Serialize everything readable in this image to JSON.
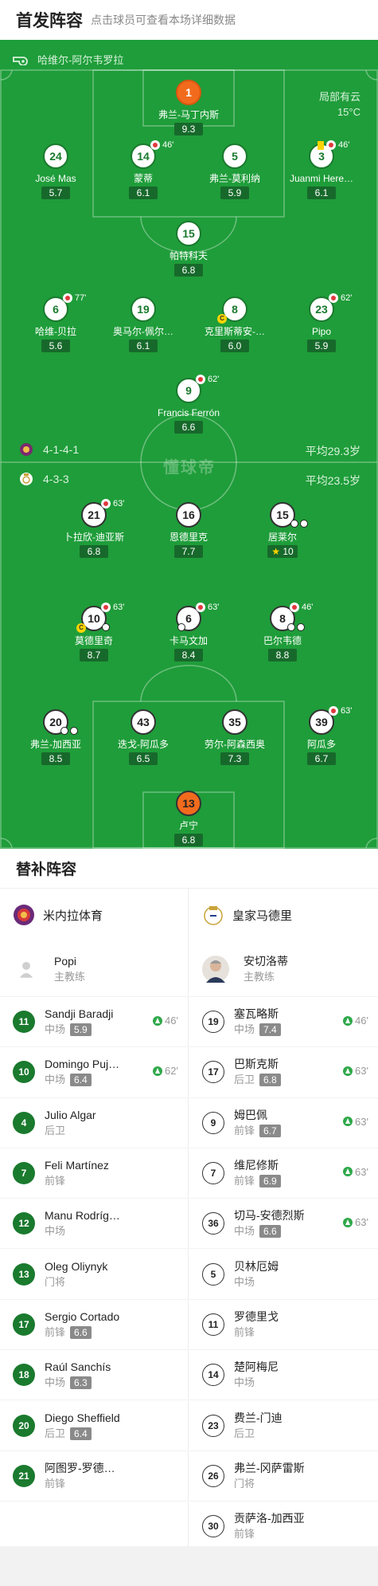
{
  "header": {
    "title": "首发阵容",
    "subtitle": "点击球员可查看本场详细数据"
  },
  "match": {
    "venue": "哈维尔-阿尔韦罗拉",
    "weather": "局部有云",
    "temperature": "15°C",
    "watermark": "懂球帝"
  },
  "home": {
    "formation": "4-1-4-1",
    "avg_age": "平均29.3岁",
    "players": [
      {
        "num": "1",
        "name": "弗兰-马丁内斯",
        "rating": "9.3"
      },
      {
        "num": "24",
        "name": "José Mas",
        "rating": "5.7"
      },
      {
        "num": "14",
        "name": "蒙蒂",
        "rating": "6.1",
        "sub_min": "46'"
      },
      {
        "num": "5",
        "name": "弗兰-莫利纳",
        "rating": "5.9"
      },
      {
        "num": "3",
        "name": "Juanmi Here…",
        "rating": "6.1",
        "sub_min": "46'"
      },
      {
        "num": "15",
        "name": "帕特科夫",
        "rating": "6.8"
      },
      {
        "num": "6",
        "name": "哈维-贝拉",
        "rating": "5.6",
        "sub_min": "77'"
      },
      {
        "num": "19",
        "name": "奥马尔-佩尔…",
        "rating": "6.1"
      },
      {
        "num": "8",
        "name": "克里斯蒂安-…",
        "rating": "6.0",
        "captain": "C"
      },
      {
        "num": "23",
        "name": "Pipo",
        "rating": "5.9",
        "sub_min": "62'"
      },
      {
        "num": "9",
        "name": "Francis Ferrón",
        "rating": "6.6",
        "sub_min": "62'"
      }
    ]
  },
  "away": {
    "formation": "4-3-3",
    "avg_age": "平均23.5岁",
    "players": [
      {
        "num": "21",
        "name": "卜拉欣-迪亚斯",
        "rating": "6.8",
        "sub_min": "63'"
      },
      {
        "num": "16",
        "name": "恩德里克",
        "rating": "7.7"
      },
      {
        "num": "15",
        "name": "居莱尔",
        "rating": "10"
      },
      {
        "num": "10",
        "name": "莫德里奇",
        "rating": "8.7",
        "sub_min": "63'",
        "captain": "C"
      },
      {
        "num": "6",
        "name": "卡马文加",
        "rating": "8.4",
        "sub_min": "63'"
      },
      {
        "num": "8",
        "name": "巴尔韦德",
        "rating": "8.8",
        "sub_min": "46'"
      },
      {
        "num": "20",
        "name": "弗兰-加西亚",
        "rating": "8.5"
      },
      {
        "num": "43",
        "name": "迭戈-阿瓜多",
        "rating": "6.5"
      },
      {
        "num": "35",
        "name": "劳尔-阿森西奥",
        "rating": "7.3"
      },
      {
        "num": "39",
        "name": "阿瓜多",
        "rating": "6.7",
        "sub_min": "63'"
      },
      {
        "num": "13",
        "name": "卢宁",
        "rating": "6.8"
      }
    ]
  },
  "subs": {
    "title": "替补阵容",
    "home": {
      "team": "米内拉体育",
      "coach": {
        "name": "Popi",
        "role": "主教练"
      },
      "players": [
        {
          "num": "11",
          "name": "Sandji Baradji",
          "pos": "中场",
          "rating": "5.9",
          "min": "46'"
        },
        {
          "num": "10",
          "name": "Domingo Puj…",
          "pos": "中场",
          "rating": "6.4",
          "min": "62'"
        },
        {
          "num": "4",
          "name": "Julio Algar",
          "pos": "后卫",
          "rating": "",
          "min": ""
        },
        {
          "num": "7",
          "name": "Feli Martínez",
          "pos": "前锋",
          "rating": "",
          "min": ""
        },
        {
          "num": "12",
          "name": "Manu Rodríg…",
          "pos": "中场",
          "rating": "",
          "min": ""
        },
        {
          "num": "13",
          "name": "Oleg Oliynyk",
          "pos": "门将",
          "rating": "",
          "min": ""
        },
        {
          "num": "17",
          "name": "Sergio Cortado",
          "pos": "前锋",
          "rating": "6.6",
          "min": ""
        },
        {
          "num": "18",
          "name": "Raúl Sanchís",
          "pos": "中场",
          "rating": "6.3",
          "min": ""
        },
        {
          "num": "20",
          "name": "Diego Sheffield",
          "pos": "后卫",
          "rating": "6.4",
          "min": ""
        },
        {
          "num": "21",
          "name": "阿图罗-罗德…",
          "pos": "前锋",
          "rating": "",
          "min": ""
        }
      ]
    },
    "away": {
      "team": "皇家马德里",
      "coach": {
        "name": "安切洛蒂",
        "role": "主教练"
      },
      "players": [
        {
          "num": "19",
          "name": "塞瓦略斯",
          "pos": "中场",
          "rating": "7.4",
          "min": "46'"
        },
        {
          "num": "17",
          "name": "巴斯克斯",
          "pos": "后卫",
          "rating": "6.8",
          "min": "63'"
        },
        {
          "num": "9",
          "name": "姆巴佩",
          "pos": "前锋",
          "rating": "6.7",
          "min": "63'"
        },
        {
          "num": "7",
          "name": "维尼修斯",
          "pos": "前锋",
          "rating": "6.9",
          "min": "63'"
        },
        {
          "num": "36",
          "name": "切马-安德烈斯",
          "pos": "中场",
          "rating": "6.6",
          "min": "63'"
        },
        {
          "num": "5",
          "name": "贝林厄姆",
          "pos": "中场",
          "rating": "",
          "min": ""
        },
        {
          "num": "11",
          "name": "罗德里戈",
          "pos": "前锋",
          "rating": "",
          "min": ""
        },
        {
          "num": "14",
          "name": "楚阿梅尼",
          "pos": "中场",
          "rating": "",
          "min": ""
        },
        {
          "num": "23",
          "name": "费兰-门迪",
          "pos": "后卫",
          "rating": "",
          "min": ""
        },
        {
          "num": "26",
          "name": "弗兰-冈萨雷斯",
          "pos": "门将",
          "rating": "",
          "min": ""
        },
        {
          "num": "30",
          "name": "贡萨洛-加西亚",
          "pos": "前锋",
          "rating": "",
          "min": ""
        }
      ]
    }
  },
  "colors": {
    "pitch": "#1f9d3a",
    "home_accent": "#1a7a2e",
    "goalkeeper": "#f26b1d",
    "sub_in": "#2fa84a"
  }
}
